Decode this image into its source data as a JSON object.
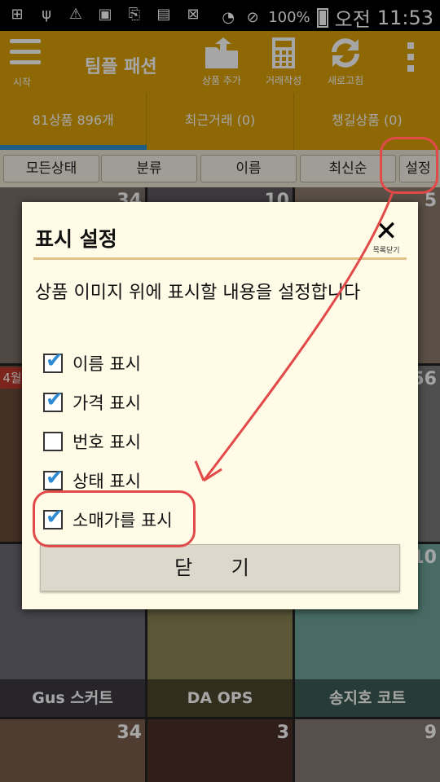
{
  "status_bar": {
    "battery": "100%",
    "ampm": "오전",
    "time": "11:53",
    "icons": [
      "add-box-icon",
      "usb-icon",
      "warning-icon",
      "image-icon",
      "sync-file-icon",
      "sd-card-icon",
      "no-image-icon",
      "wifi-icon",
      "do-not-disturb-icon",
      "battery-icon"
    ]
  },
  "app_bar": {
    "menu_label": "시작",
    "title": "팀플 패션",
    "actions": [
      {
        "label": "상품 추가",
        "icon": "folder-upload-icon"
      },
      {
        "label": "거래작성",
        "icon": "calculator-icon"
      },
      {
        "label": "새로고침",
        "icon": "refresh-icon"
      }
    ]
  },
  "tabs": [
    "81상품 896개",
    "최근거래 (0)",
    "챙길상품 (0)"
  ],
  "filters": [
    "모든상태",
    "분류",
    "이름",
    "최신순",
    "설정"
  ],
  "grid": {
    "tiles": [
      {
        "num": "34",
        "name": ""
      },
      {
        "num": "10",
        "name": ""
      },
      {
        "num": "5",
        "name": ""
      },
      {
        "num": "",
        "name": ""
      },
      {
        "num": "",
        "name": ""
      },
      {
        "num": "56",
        "name": ""
      },
      {
        "num": "",
        "name": ""
      },
      {
        "num": "",
        "name": ""
      },
      {
        "num": "10",
        "name": ""
      },
      {
        "num": "",
        "name": "Gus 스커트"
      },
      {
        "num": "",
        "name": "DA OPS"
      },
      {
        "num": "",
        "name": "송지호 코트"
      },
      {
        "num": "34",
        "name": ""
      },
      {
        "num": "3",
        "name": ""
      },
      {
        "num": "9",
        "name": ""
      }
    ],
    "side_label": "4월"
  },
  "dialog": {
    "title": "표시 설정",
    "close_label": "목록닫기",
    "description": "상품 이미지 위에 표시할 내용을 설정합니다",
    "options": [
      {
        "label": "이름 표시",
        "checked": true
      },
      {
        "label": "가격 표시",
        "checked": true
      },
      {
        "label": "번호 표시",
        "checked": false
      },
      {
        "label": "상태 표시",
        "checked": true
      },
      {
        "label": "소매가를 표시",
        "checked": true
      }
    ],
    "button_label": "닫 기"
  },
  "colors": {
    "app_bar": "#d9a008",
    "tab_indicator": "#2f8ec7",
    "dialog_bg": "#fffbe6",
    "checkbox": "#2e8bd2",
    "annotation": "#e24a4a"
  }
}
